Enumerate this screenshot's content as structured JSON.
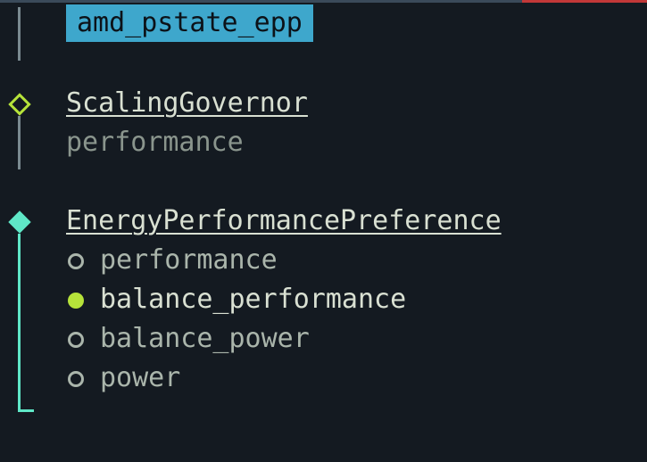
{
  "colors": {
    "bg": "#141a21",
    "highlight_bg": "#3ea7cc",
    "highlight_fg": "#0c1218",
    "tree_line": "#7a8a90",
    "tree_line_active": "#5fe7c7",
    "diamond_outline": "#b6e33a",
    "diamond_solid": "#5fe7c7",
    "title_fg": "#d9e0d2",
    "dim_fg": "#8a958d",
    "opt_fg": "#aab5ab",
    "radio_fill": "#b6e33a"
  },
  "highlighted_item": "amd_pstate_epp",
  "sections": [
    {
      "title": "ScalingGovernor",
      "value": "performance"
    },
    {
      "title": "EnergyPerformancePreference",
      "options": [
        {
          "label": "performance",
          "selected": false
        },
        {
          "label": "balance_performance",
          "selected": true
        },
        {
          "label": "balance_power",
          "selected": false
        },
        {
          "label": "power",
          "selected": false
        }
      ]
    }
  ]
}
